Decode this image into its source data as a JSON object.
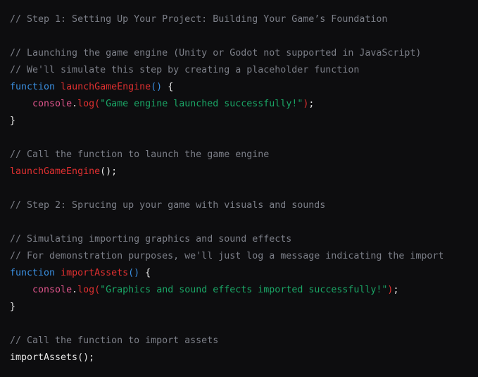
{
  "code_block": {
    "language": "javascript",
    "background_color": "#0d0d0f",
    "colors": {
      "comment": "#7c7f88",
      "keyword": "#3a8fe0",
      "function_name": "#e03030",
      "object": "#e0558c",
      "property": "#e03030",
      "string": "#1aa666",
      "punctuation": "#e6e6e6",
      "plain_text": "#e6e6e6"
    },
    "lines": [
      {
        "tokens": [
          {
            "t": "// Step 1: Setting Up Your Project: Building Your Game’s Foundation",
            "c": "cmt"
          }
        ]
      },
      {
        "tokens": []
      },
      {
        "tokens": [
          {
            "t": "// Launching the game engine (Unity or Godot not supported in JavaScript)",
            "c": "cmt"
          }
        ]
      },
      {
        "tokens": [
          {
            "t": "// We'll simulate this step by creating a placeholder function",
            "c": "cmt"
          }
        ]
      },
      {
        "tokens": [
          {
            "t": "function",
            "c": "kw"
          },
          {
            "t": " ",
            "c": "plain"
          },
          {
            "t": "launchGameEngine",
            "c": "fn"
          },
          {
            "t": "()",
            "c": "pblue"
          },
          {
            "t": " ",
            "c": "plain"
          },
          {
            "t": "{",
            "c": "punc"
          }
        ]
      },
      {
        "tokens": [
          {
            "t": "    ",
            "c": "plain"
          },
          {
            "t": "console",
            "c": "obj"
          },
          {
            "t": ".",
            "c": "punc"
          },
          {
            "t": "log",
            "c": "prop"
          },
          {
            "t": "(",
            "c": "prop"
          },
          {
            "t": "\"Game engine launched successfully!\"",
            "c": "str"
          },
          {
            "t": ")",
            "c": "prop"
          },
          {
            "t": ";",
            "c": "punc"
          }
        ]
      },
      {
        "tokens": [
          {
            "t": "}",
            "c": "punc"
          }
        ]
      },
      {
        "tokens": []
      },
      {
        "tokens": [
          {
            "t": "// Call the function to launch the game engine",
            "c": "cmt"
          }
        ]
      },
      {
        "tokens": [
          {
            "t": "launchGameEngine",
            "c": "fn"
          },
          {
            "t": "()",
            "c": "punc"
          },
          {
            "t": ";",
            "c": "punc"
          }
        ]
      },
      {
        "tokens": []
      },
      {
        "tokens": [
          {
            "t": "// Step 2: Sprucing up your game with visuals and sounds",
            "c": "cmt"
          }
        ]
      },
      {
        "tokens": []
      },
      {
        "tokens": [
          {
            "t": "// Simulating importing graphics and sound effects",
            "c": "cmt"
          }
        ]
      },
      {
        "tokens": [
          {
            "t": "// For demonstration purposes, we'll just log a message indicating the import",
            "c": "cmt"
          }
        ]
      },
      {
        "tokens": [
          {
            "t": "function",
            "c": "kw"
          },
          {
            "t": " ",
            "c": "plain"
          },
          {
            "t": "importAssets",
            "c": "fn"
          },
          {
            "t": "()",
            "c": "pblue"
          },
          {
            "t": " ",
            "c": "plain"
          },
          {
            "t": "{",
            "c": "punc"
          }
        ]
      },
      {
        "tokens": [
          {
            "t": "    ",
            "c": "plain"
          },
          {
            "t": "console",
            "c": "obj"
          },
          {
            "t": ".",
            "c": "punc"
          },
          {
            "t": "log",
            "c": "prop"
          },
          {
            "t": "(",
            "c": "prop"
          },
          {
            "t": "\"Graphics and sound effects imported successfully!\"",
            "c": "str"
          },
          {
            "t": ")",
            "c": "prop"
          },
          {
            "t": ";",
            "c": "punc"
          }
        ]
      },
      {
        "tokens": [
          {
            "t": "}",
            "c": "punc"
          }
        ]
      },
      {
        "tokens": []
      },
      {
        "tokens": [
          {
            "t": "// Call the function to import assets",
            "c": "cmt"
          }
        ]
      },
      {
        "tokens": [
          {
            "t": "importAssets();",
            "c": "plain"
          }
        ]
      }
    ]
  }
}
